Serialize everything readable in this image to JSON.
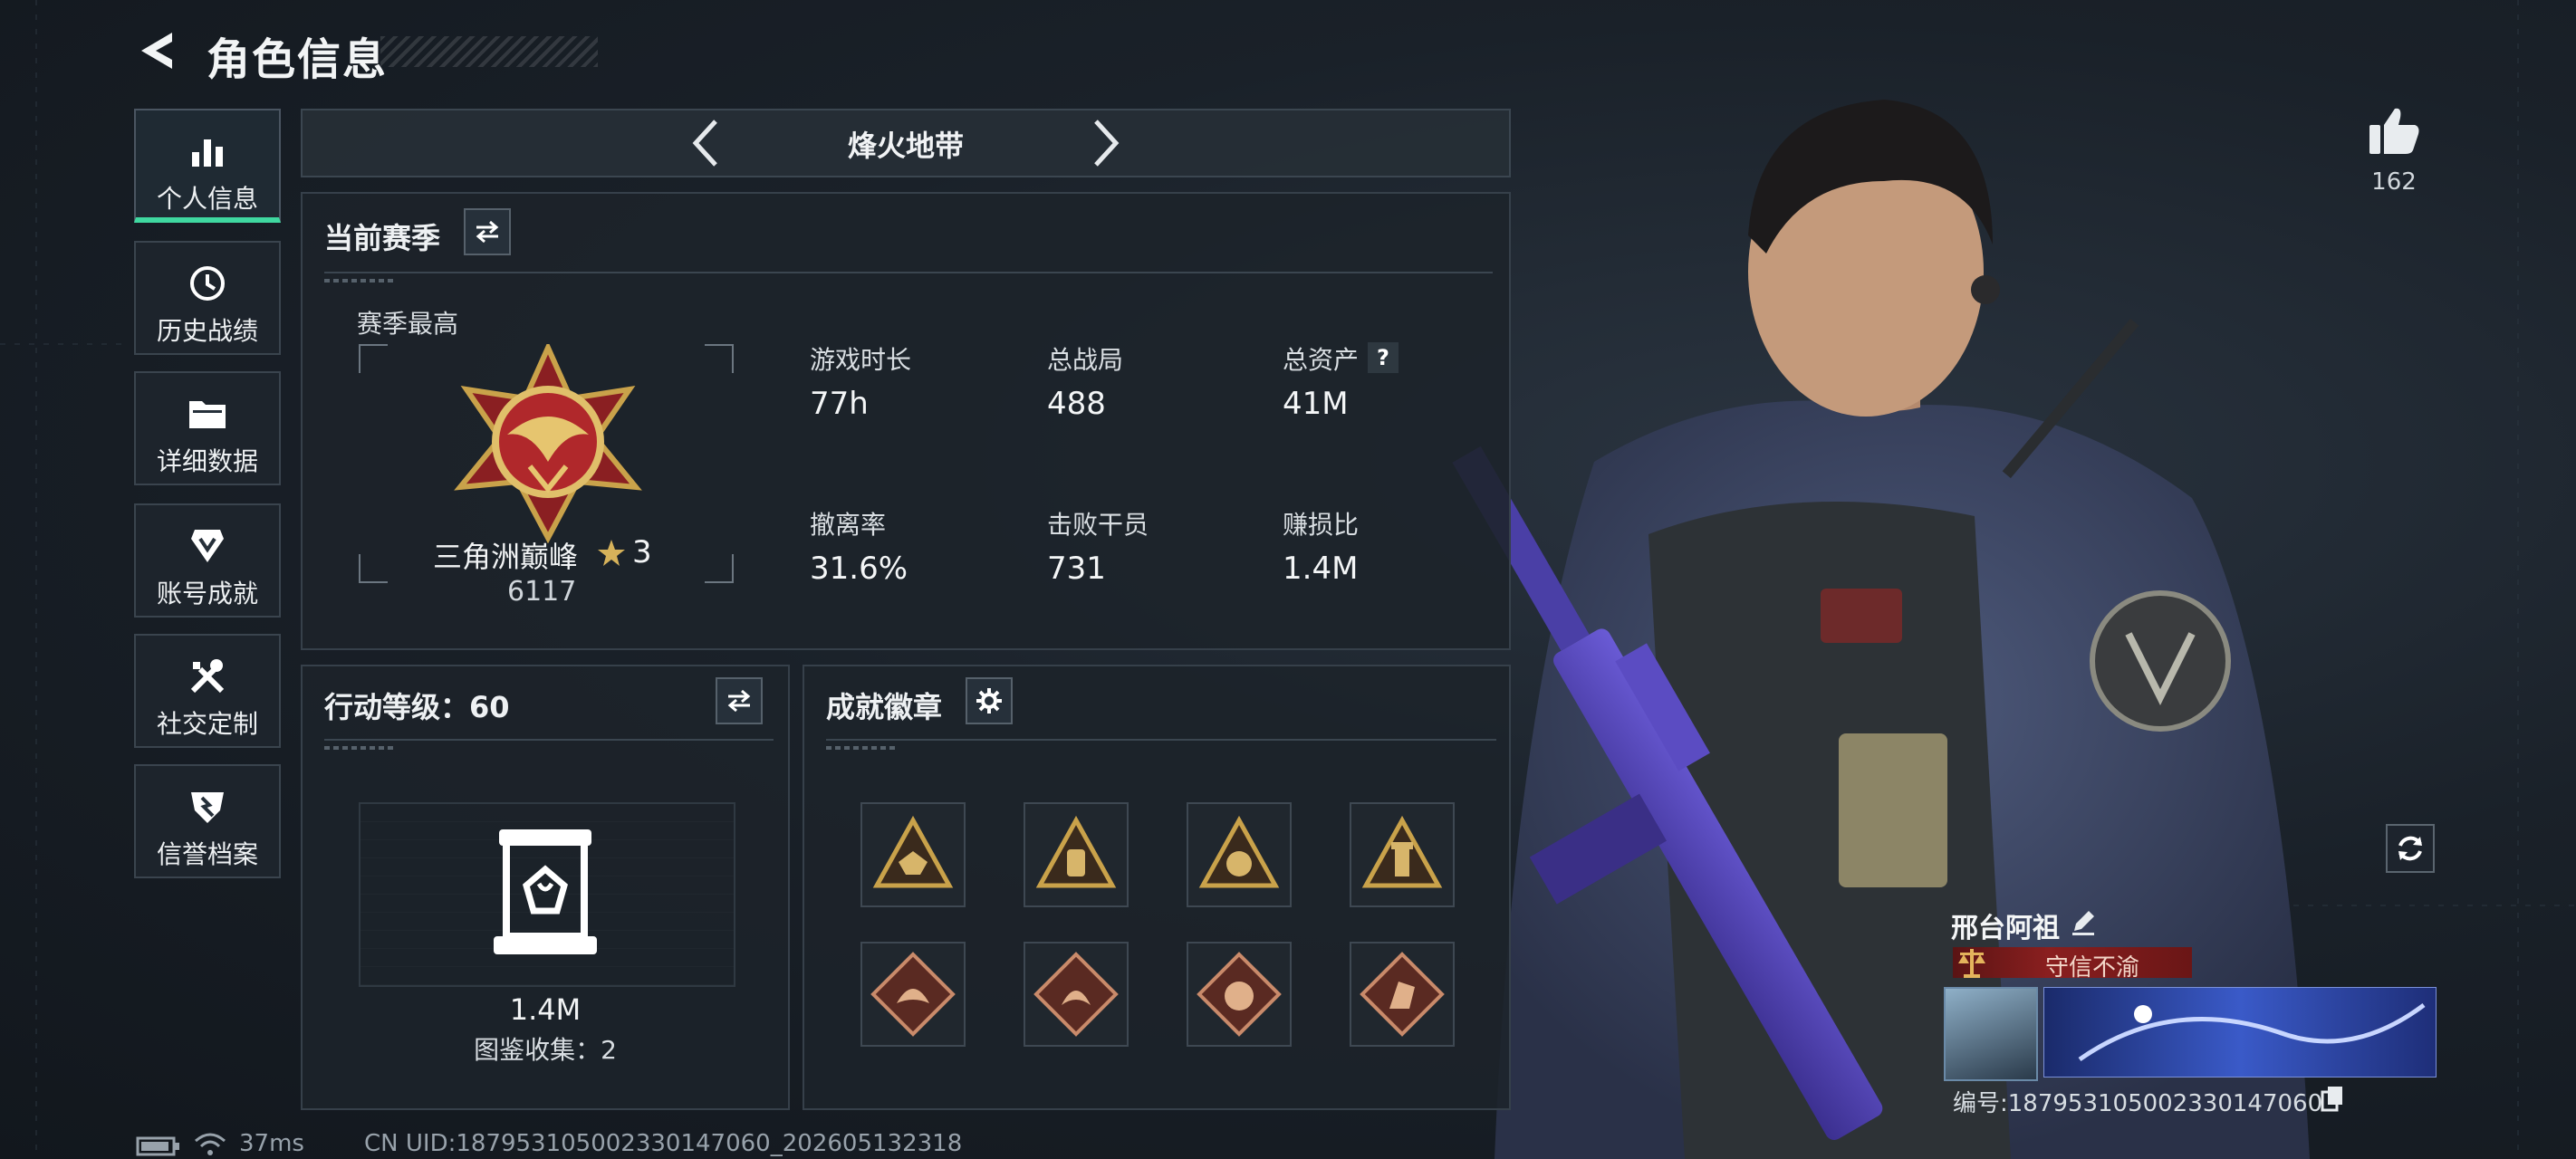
{
  "header": {
    "title": "角色信息"
  },
  "sidebar": {
    "items": [
      {
        "label": "个人信息",
        "icon": "bar-chart-icon"
      },
      {
        "label": "历史战绩",
        "icon": "history-icon"
      },
      {
        "label": "详细数据",
        "icon": "folder-icon"
      },
      {
        "label": "账号成就",
        "icon": "achievement-icon"
      },
      {
        "label": "社交定制",
        "icon": "tools-icon"
      },
      {
        "label": "信誉档案",
        "icon": "shield-icon"
      }
    ]
  },
  "mode": {
    "label": "烽火地带"
  },
  "season": {
    "title": "当前赛季",
    "highest_label": "赛季最高",
    "rank_name": "三角洲巅峰",
    "rank_stars": "3",
    "rank_score": "6117",
    "stats": [
      {
        "label": "游戏时长",
        "value": "77h"
      },
      {
        "label": "总战局",
        "value": "488"
      },
      {
        "label": "总资产",
        "value": "41M"
      },
      {
        "label": "撤离率",
        "value": "31.6%"
      },
      {
        "label": "击败干员",
        "value": "731"
      },
      {
        "label": "赚损比",
        "value": "1.4M"
      }
    ],
    "help_mark": "?"
  },
  "action_level": {
    "title": "行动等级：60",
    "value": "1.4M",
    "collection": "图鉴收集：2"
  },
  "achievements": {
    "title": "成就徽章"
  },
  "profile": {
    "likes": "162",
    "name": "邢台阿祖",
    "reputation": "守信不渝",
    "player_id": "编号:187953105002330147060"
  },
  "status_bar": {
    "ping": "37ms",
    "uid": "CN UID:187953105002330147060_202605132318"
  },
  "colors": {
    "accent": "#3fd8a0",
    "reputation_red": "#8a1f1f",
    "gold": "#c9a24a"
  }
}
